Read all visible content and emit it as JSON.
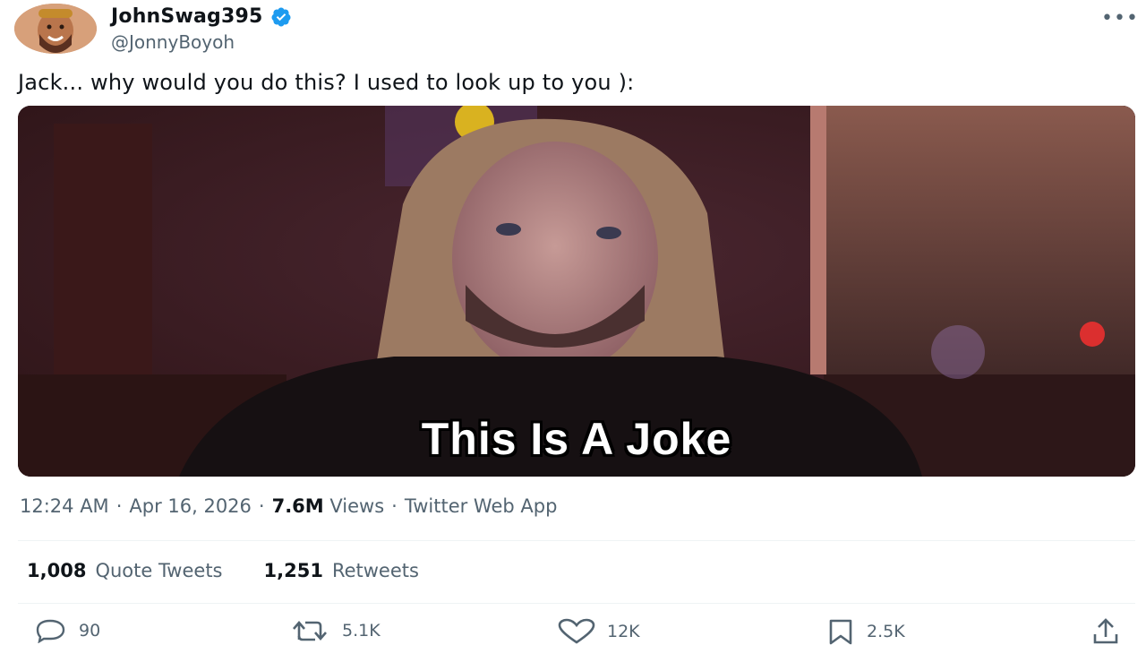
{
  "author": {
    "display_name": "JohnSwag395",
    "handle": "@JonnyBoyoh",
    "verified_icon": "verified-badge-icon",
    "avatar_icon": "avatar"
  },
  "more_icon": "more-icon",
  "tweet": {
    "text": "Jack... why would you do this? I used to look up to you ):",
    "media_caption": "This Is A Joke"
  },
  "meta": {
    "time": "12:24 AM",
    "sep1": "·",
    "date": "Apr 16, 2026",
    "sep2": "·",
    "views_count": "7.6M",
    "views_label": "Views",
    "sep3": "·",
    "source": "Twitter Web App"
  },
  "stats": {
    "quote_count": "1,008",
    "quote_label": "Quote Tweets",
    "retweet_count": "1,251",
    "retweet_label": "Retweets"
  },
  "actions": {
    "reply_count": "90",
    "retweet_count": "5.1K",
    "like_count": "12K",
    "bookmark_count": "2.5K"
  },
  "colors": {
    "accent": "#1d9bf0",
    "muted": "#536471",
    "text": "#0f1419"
  }
}
